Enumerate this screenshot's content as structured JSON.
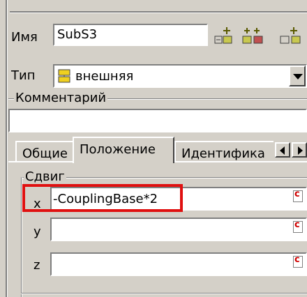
{
  "form": {
    "name_label": "Имя",
    "name_value": "SubS3",
    "type_label": "Тип",
    "type_value": "внешняя",
    "comment_label": "Комментарий",
    "comment_value": ""
  },
  "tabs": [
    {
      "label": "Общие"
    },
    {
      "label": "Положение"
    },
    {
      "label": "Идентифика"
    }
  ],
  "offset": {
    "group_label": "Сдвиг",
    "x_label": "x",
    "x_value": "-CouplingBase*2",
    "y_label": "y",
    "y_value": "",
    "z_label": "z",
    "z_value": "",
    "constant_marker": "c"
  },
  "icons": {
    "add_a": "add-node-icon",
    "add_b": "add-multi-node-icon",
    "add_c": "add-node-partial-icon",
    "type": "block-type-icon",
    "dropdown": "chevron-down-icon",
    "tab_left": "arrow-left-icon",
    "tab_right": "arrow-right-icon"
  },
  "highlight_color": "#e01010"
}
